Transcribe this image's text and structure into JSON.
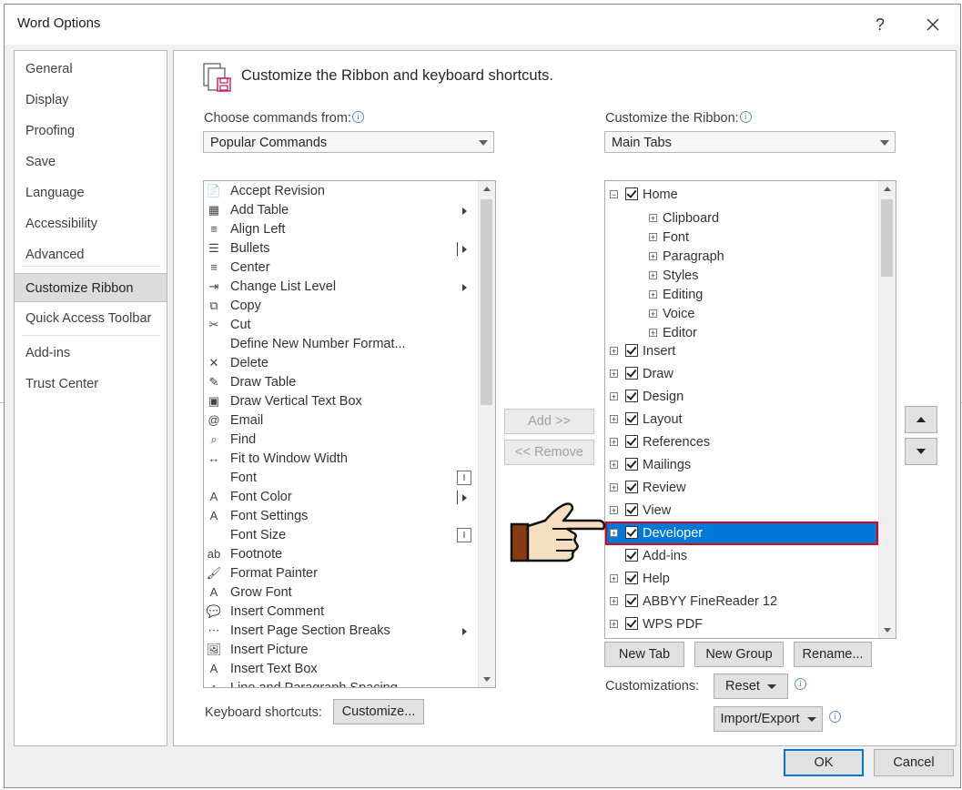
{
  "window": {
    "title": "Word Options",
    "help": "?",
    "close": "✕"
  },
  "nav": {
    "items": [
      {
        "label": "General"
      },
      {
        "label": "Display"
      },
      {
        "label": "Proofing"
      },
      {
        "label": "Save"
      },
      {
        "label": "Language"
      },
      {
        "label": "Accessibility"
      },
      {
        "label": "Advanced"
      },
      {
        "label": "Customize Ribbon"
      },
      {
        "label": "Quick Access Toolbar"
      },
      {
        "label": "Add-ins"
      },
      {
        "label": "Trust Center"
      }
    ],
    "active": "Customize Ribbon"
  },
  "main": {
    "heading": "Customize the Ribbon and keyboard shortcuts.",
    "choose_label": "Choose commands from:",
    "choose_value": "Popular Commands",
    "ribbon_label": "Customize the Ribbon:",
    "ribbon_value": "Main Tabs",
    "commands": [
      {
        "label": "Accept Revision",
        "icon": "accept-revision-icon",
        "glyph": "📄"
      },
      {
        "label": "Add Table",
        "icon": "table-icon",
        "glyph": "▦"
      },
      {
        "label": "Align Left",
        "icon": "align-left-icon",
        "glyph": "≡"
      },
      {
        "label": "Bullets",
        "icon": "bullets-icon",
        "glyph": "☰"
      },
      {
        "label": "Center",
        "icon": "align-center-icon",
        "glyph": "≡"
      },
      {
        "label": "Change List Level",
        "icon": "list-level-icon",
        "glyph": "⇥"
      },
      {
        "label": "Copy",
        "icon": "copy-icon",
        "glyph": "⧉"
      },
      {
        "label": "Cut",
        "icon": "scissors-icon",
        "glyph": "✂"
      },
      {
        "label": "Define New Number Format...",
        "icon": "",
        "glyph": ""
      },
      {
        "label": "Delete",
        "icon": "delete-icon",
        "glyph": "✕"
      },
      {
        "label": "Draw Table",
        "icon": "draw-table-icon",
        "glyph": "✎"
      },
      {
        "label": "Draw Vertical Text Box",
        "icon": "vertical-textbox-icon",
        "glyph": "▣"
      },
      {
        "label": "Email",
        "icon": "email-icon",
        "glyph": "@"
      },
      {
        "label": "Find",
        "icon": "magnifier-icon",
        "glyph": "⌕"
      },
      {
        "label": "Fit to Window Width",
        "icon": "fit-width-icon",
        "glyph": "↔"
      },
      {
        "label": "Font",
        "icon": "",
        "glyph": ""
      },
      {
        "label": "Font Color",
        "icon": "font-color-icon",
        "glyph": "A"
      },
      {
        "label": "Font Settings",
        "icon": "font-settings-icon",
        "glyph": "A"
      },
      {
        "label": "Font Size",
        "icon": "",
        "glyph": ""
      },
      {
        "label": "Footnote",
        "icon": "footnote-icon",
        "glyph": "ab"
      },
      {
        "label": "Format Painter",
        "icon": "paintbrush-icon",
        "glyph": "🖌"
      },
      {
        "label": "Grow Font",
        "icon": "grow-font-icon",
        "glyph": "A"
      },
      {
        "label": "Insert Comment",
        "icon": "comment-icon",
        "glyph": "💬"
      },
      {
        "label": "Insert Page  Section Breaks",
        "icon": "page-break-icon",
        "glyph": "⋯"
      },
      {
        "label": "Insert Picture",
        "icon": "picture-icon",
        "glyph": "🖼"
      },
      {
        "label": "Insert Text Box",
        "icon": "textbox-icon",
        "glyph": "A"
      },
      {
        "label": "Line and Paragraph Spacing",
        "icon": "line-spacing-icon",
        "glyph": "↕"
      }
    ],
    "add_button": "Add >>",
    "remove_button": "<< Remove",
    "tabs_tree": [
      {
        "label": "Home",
        "level": 0,
        "expanded": true,
        "checked": true
      },
      {
        "label": "Clipboard",
        "level": 1
      },
      {
        "label": "Font",
        "level": 1
      },
      {
        "label": "Paragraph",
        "level": 1
      },
      {
        "label": "Styles",
        "level": 1
      },
      {
        "label": "Editing",
        "level": 1
      },
      {
        "label": "Voice",
        "level": 1
      },
      {
        "label": "Editor",
        "level": 1
      },
      {
        "label": "Insert",
        "level": 0,
        "checked": true
      },
      {
        "label": "Draw",
        "level": 0,
        "checked": true
      },
      {
        "label": "Design",
        "level": 0,
        "checked": true
      },
      {
        "label": "Layout",
        "level": 0,
        "checked": true
      },
      {
        "label": "References",
        "level": 0,
        "checked": true
      },
      {
        "label": "Mailings",
        "level": 0,
        "checked": true
      },
      {
        "label": "Review",
        "level": 0,
        "checked": true
      },
      {
        "label": "View",
        "level": 0,
        "checked": true
      },
      {
        "label": "Developer",
        "level": 0,
        "checked": true,
        "selected": true
      },
      {
        "label": "Add-ins",
        "level": 0,
        "checked": true,
        "noexpander": true
      },
      {
        "label": "Help",
        "level": 0,
        "checked": true
      },
      {
        "label": "ABBYY FineReader 12",
        "level": 0,
        "checked": true
      },
      {
        "label": "WPS PDF",
        "level": 0,
        "checked": true
      }
    ],
    "new_tab": "New Tab",
    "new_group": "New Group",
    "rename": "Rename...",
    "customizations_label": "Customizations:",
    "reset": "Reset",
    "import_export": "Import/Export",
    "keyboard_label": "Keyboard shortcuts:",
    "customize_button": "Customize..."
  },
  "footer": {
    "ok": "OK",
    "cancel": "Cancel"
  },
  "colors": {
    "selection": "#0078d7",
    "highlight_border": "#e0001b",
    "ok_border": "#0078d7"
  }
}
